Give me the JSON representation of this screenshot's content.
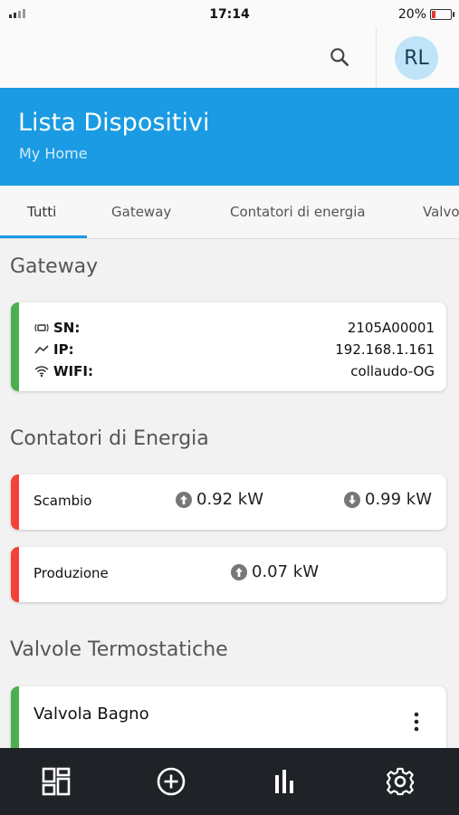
{
  "status_bar": {
    "time": "17:14",
    "battery": "20%",
    "battery_level": 0.2
  },
  "app_bar": {
    "avatar_initials": "RL",
    "search_icon": "search-icon"
  },
  "header": {
    "title": "Lista Dispositivi",
    "subtitle": "My Home",
    "color": "#1a9be3"
  },
  "tabs": [
    {
      "label": "Tutti",
      "selected": true
    },
    {
      "label": "Gateway"
    },
    {
      "label": "Contatori di energia"
    },
    {
      "label": "Valvo"
    }
  ],
  "gateway": {
    "section_title": "Gateway",
    "rows": [
      {
        "icon": "antenna-icon",
        "label": "SN:",
        "value": "2105A00001"
      },
      {
        "icon": "network-icon",
        "label": "IP:",
        "value": "192.168.1.161"
      },
      {
        "icon": "wifi-icon",
        "label": "WIFI:",
        "value": "collaudo-OG"
      }
    ],
    "status_color": "#4caf50"
  },
  "energy": {
    "section_title": "Contatori di Energia",
    "meters": [
      {
        "label": "Scambio",
        "import": "0.92 kW",
        "export": "0.99 kW"
      },
      {
        "label": "Produzione",
        "import": "0.07 kW"
      }
    ],
    "status_color": "#f44336"
  },
  "valves": {
    "section_title": "Valvole Termostatiche",
    "items": [
      {
        "label": "Valvola Bagno"
      }
    ]
  },
  "bottom_nav": [
    {
      "icon": "dashboard-icon"
    },
    {
      "icon": "add-circle-icon"
    },
    {
      "icon": "bar-chart-icon"
    },
    {
      "icon": "gear-icon"
    }
  ]
}
